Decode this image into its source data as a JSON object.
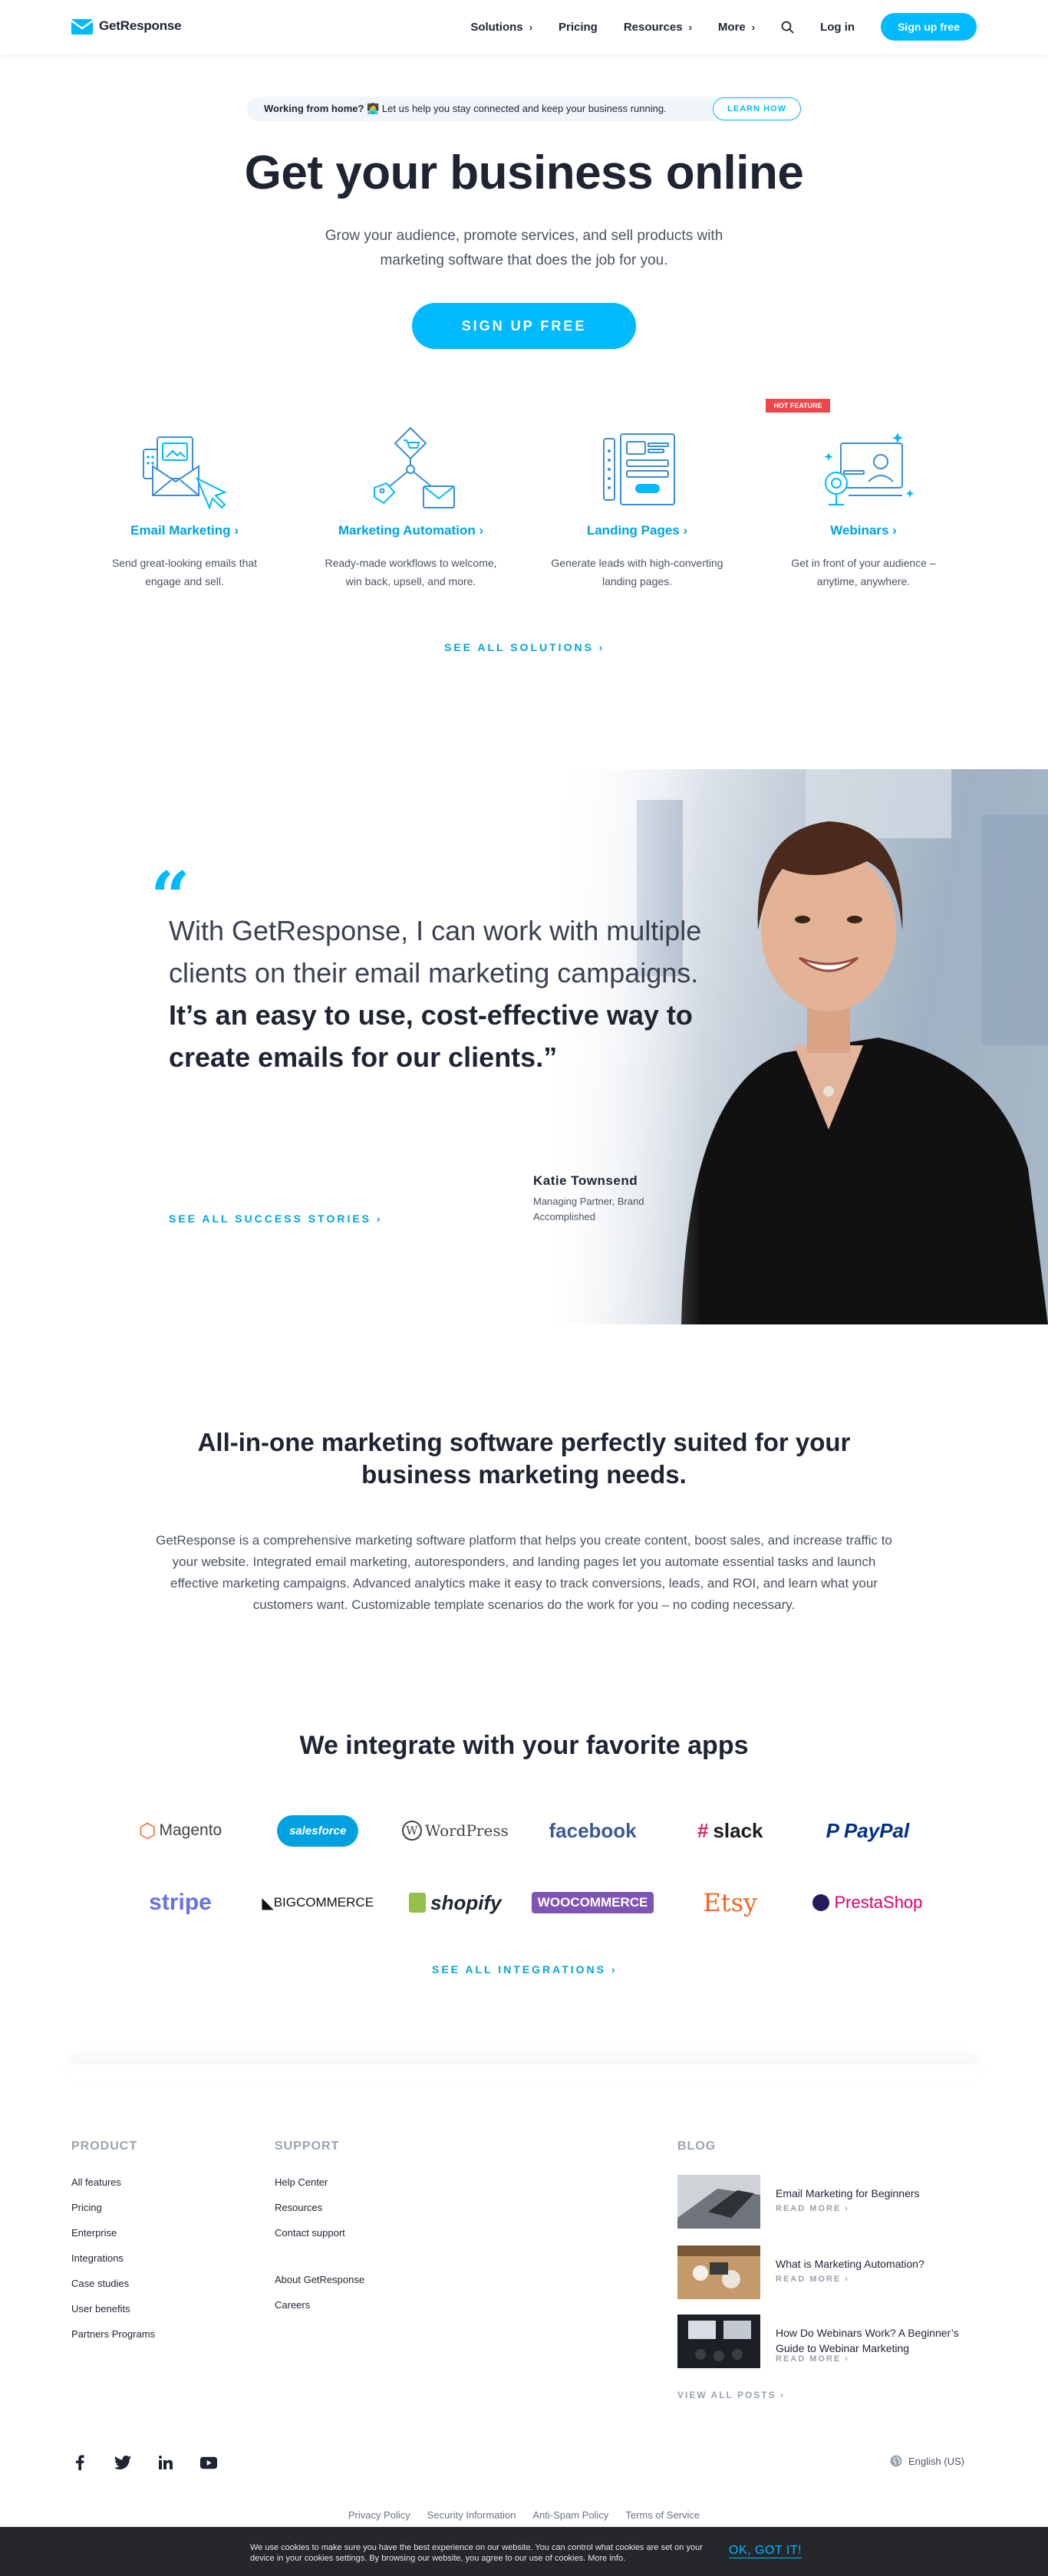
{
  "header": {
    "logo_text": "GetResponse",
    "nav": [
      {
        "label": "Solutions",
        "has_chevron": true
      },
      {
        "label": "Pricing",
        "has_chevron": false
      },
      {
        "label": "Resources",
        "has_chevron": true
      },
      {
        "label": "More",
        "has_chevron": true
      }
    ],
    "login_label": "Log in",
    "signup_label": "Sign up free"
  },
  "hero": {
    "announce_bold": "Working from home?",
    "announce_rest": "Let us help you stay connected and keep your business running.",
    "learn_label": "LEARN HOW",
    "title": "Get your business online",
    "subtitle": "Grow your audience, promote services, and sell products with marketing software that does the job for you.",
    "cta_label": "SIGN UP FREE"
  },
  "features": {
    "items": [
      {
        "title": "Email Marketing ›",
        "desc": "Send great-looking emails that engage and sell."
      },
      {
        "title": "Marketing Automation ›",
        "desc": "Ready-made workflows to welcome, win back, upsell, and more."
      },
      {
        "title": "Landing Pages ›",
        "desc": "Generate leads with high-converting landing pages."
      },
      {
        "title": "Webinars ›",
        "desc": "Get in front of your audience – anytime, anywhere."
      }
    ],
    "hot_badge": "HOT FEATURE",
    "see_all_label": "SEE ALL SOLUTIONS ›"
  },
  "testimonial": {
    "quote_mark": "“",
    "quote_light": "With GetResponse, I can work with multiple clients on their email marketing campaigns.",
    "quote_bold": "It’s an easy to use, cost-effective way to create emails for our clients.”",
    "author_name": "Katie Townsend",
    "author_role": "Managing Partner, Brand Accomplished",
    "see_all_label": "SEE ALL SUCCESS STORIES ›"
  },
  "aio": {
    "title": "All-in-one marketing software perfectly suited for your business marketing needs.",
    "body": "GetResponse is a comprehensive marketing software platform that helps you create content, boost sales, and increase traffic to your website. Integrated email marketing, autoresponders, and landing pages let you automate essential tasks and launch effective marketing campaigns. Advanced analytics make it easy to track conversions, leads, and ROI, and learn what your customers want. Customizable template scenarios do the work for you – no coding necessary."
  },
  "integrations": {
    "title": "We integrate with your favorite apps",
    "row1": [
      {
        "name": "Magento",
        "color": "#f26322"
      },
      {
        "name": "salesforce",
        "color": "#00a1e0"
      },
      {
        "name": "WordPress",
        "color": "#464342"
      },
      {
        "name": "facebook",
        "color": "#3b5998"
      },
      {
        "name": "slack",
        "color": "#1d1c1d"
      },
      {
        "name": "PayPal",
        "color": "#003087"
      }
    ],
    "row2": [
      {
        "name": "stripe",
        "color": "#6772e5"
      },
      {
        "name": "BIGCOMMERCE",
        "color": "#121118"
      },
      {
        "name": "shopify",
        "color": "#1f2433"
      },
      {
        "name": "WOOCOMMERCE",
        "color": "#7f54b3"
      },
      {
        "name": "Etsy",
        "color": "#f1641e"
      },
      {
        "name": "PrestaShop",
        "color": "#df0067"
      }
    ],
    "see_all_label": "SEE ALL INTEGRATIONS ›"
  },
  "footer": {
    "product_head": "PRODUCT",
    "product_links": [
      "All features",
      "Pricing",
      "Enterprise",
      "Integrations",
      "Case studies",
      "User benefits",
      "Partners Programs"
    ],
    "support_head": "SUPPORT",
    "support_links": [
      "Help Center",
      "Resources",
      "Contact support"
    ],
    "company_links": [
      "About GetResponse",
      "Careers"
    ],
    "blog_head": "BLOG",
    "blog_posts": [
      {
        "title": "Email Marketing for Beginners",
        "more": "READ MORE ›"
      },
      {
        "title": "What is Marketing Automation?",
        "more": "READ MORE ›"
      },
      {
        "title": "How Do Webinars Work? A Beginner’s Guide to Webinar Marketing",
        "more": "READ MORE ›"
      }
    ],
    "view_all_label": "VIEW ALL POSTS ›",
    "social": [
      "facebook-icon",
      "twitter-icon",
      "linkedin-icon",
      "youtube-icon"
    ],
    "language": "English (US)",
    "legal": [
      "Privacy Policy",
      "Security Information",
      "Anti-Spam Policy",
      "Terms of Service"
    ]
  },
  "cookie": {
    "text": "We use cookies to make sure you have the best experience on our website. You can control what cookies are set on your device in your cookies settings. By browsing our website, you agree to our use of cookies. More info.",
    "ok_label": "OK, GOT IT!"
  },
  "colors": {
    "accent": "#00baff",
    "link": "#00a3e0",
    "text": "#1f2433",
    "badge": "#f0454b"
  }
}
